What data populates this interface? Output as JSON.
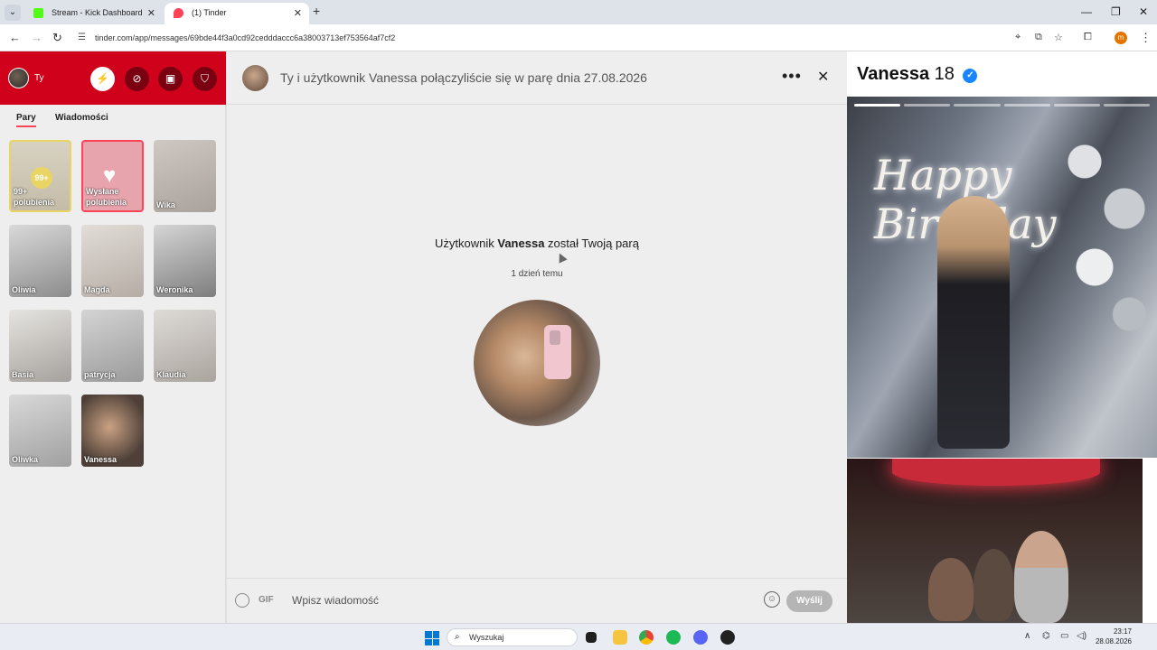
{
  "browser": {
    "tabs": [
      {
        "title": "Stream - Kick Dashboard",
        "active": false
      },
      {
        "title": "(1) Tinder",
        "active": true
      }
    ],
    "url": "tinder.com/app/messages/69bde44f3a0cd92cedddaccc6a38003713ef753564af7cf2"
  },
  "sidebar": {
    "profile_name": "Ty",
    "tabs": [
      {
        "label": "Pary",
        "active": true
      },
      {
        "label": "Wiadomości",
        "active": false
      }
    ],
    "likes_card": {
      "count": "99+",
      "label": "99+\npolubienia"
    },
    "sent_card": {
      "label": "Wysłane\npolubienia"
    },
    "matches": [
      "Wika",
      "Oliwia",
      "Magda",
      "Weronika",
      "Basia",
      "patrycja",
      "Klaudia",
      "Oliwka",
      "Vanessa"
    ]
  },
  "chat": {
    "header_title": "Ty i użytkownik Vanessa połączyliście się w parę dnia 27.08.2026",
    "match_prefix": "Użytkownik",
    "match_name": "Vanessa",
    "match_suffix": "został Twoją parą",
    "match_time": "1 dzień temu",
    "composer_gif": "GIF",
    "composer_placeholder": "Wpisz wiadomość",
    "send_label": "Wyślij"
  },
  "profile": {
    "name": "Vanessa",
    "age": "18",
    "photo_text": "Happy Birthday"
  },
  "taskbar": {
    "search_placeholder": "Wyszukaj",
    "time": "23:17",
    "date": "28.08.2026"
  },
  "colors": {
    "tinder_red": "#d0021b",
    "accent": "#ff4458",
    "likes_gold": "#e9d563",
    "verified_blue": "#1786ff"
  }
}
